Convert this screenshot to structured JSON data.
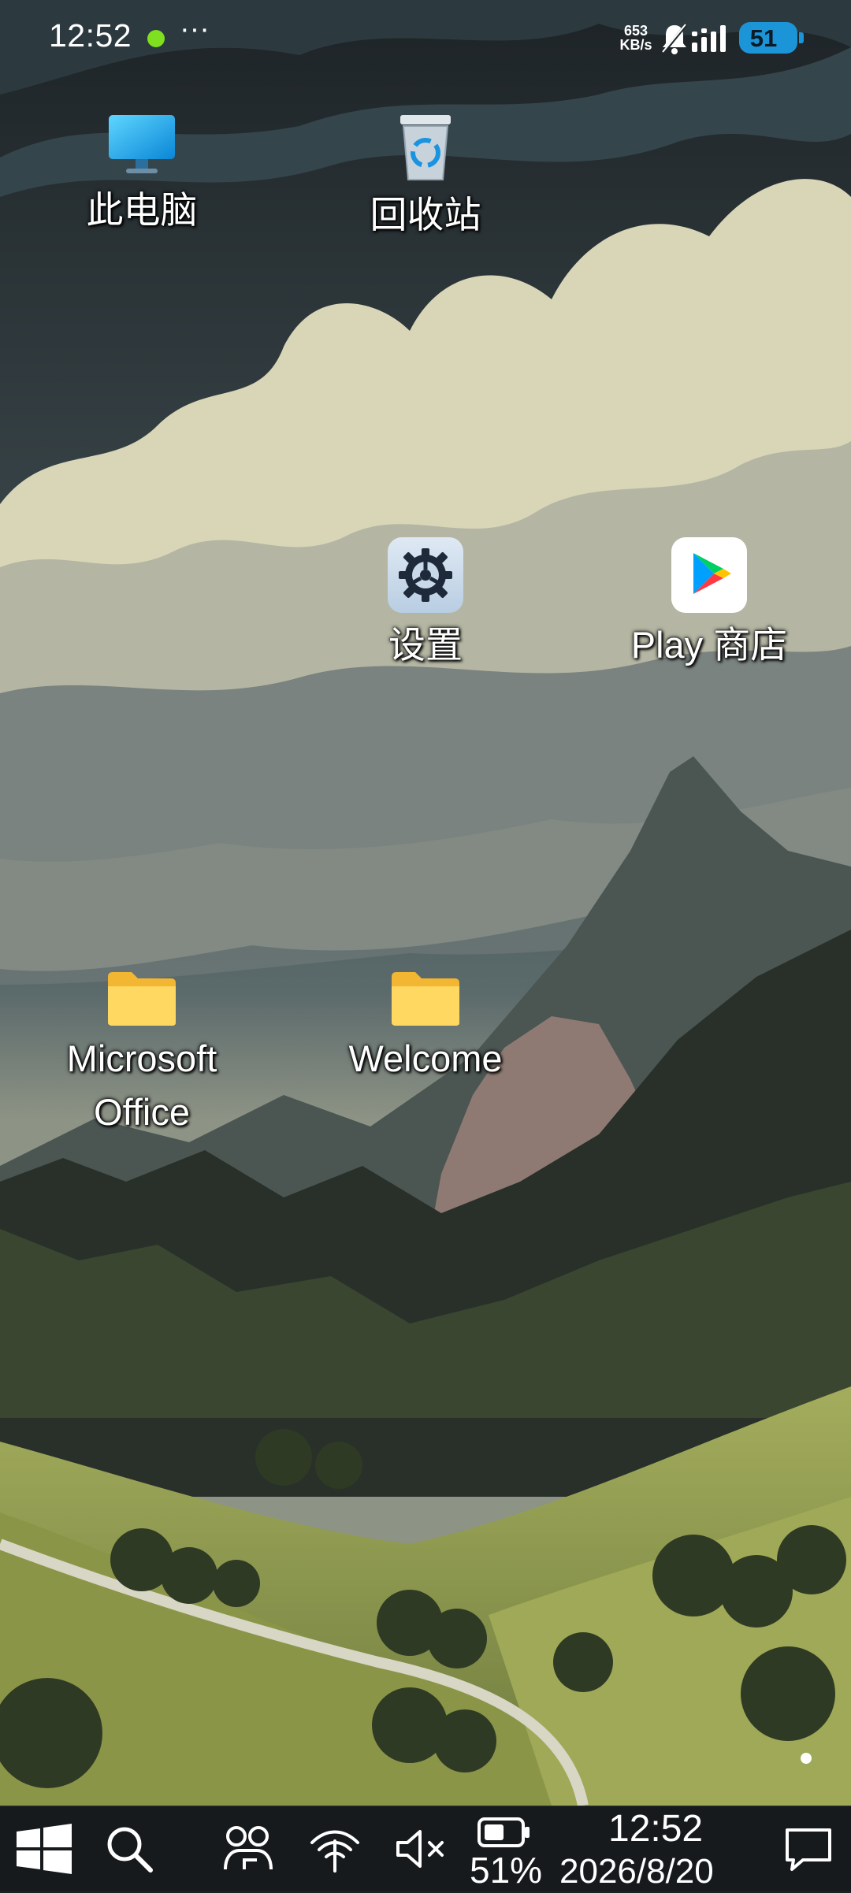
{
  "status_bar": {
    "time": "12:52",
    "net_speed_value": "653",
    "net_speed_unit": "KB/s",
    "battery_level": "51",
    "icons": [
      "online-dot-icon",
      "more-dots-icon",
      "bell-muted-icon",
      "signal-icon",
      "battery-icon"
    ],
    "colors": {
      "online_dot": "#7ee01e",
      "battery": "#1c95d8"
    }
  },
  "desktop": {
    "icons": [
      {
        "label": "此电脑",
        "icon": "monitor-icon"
      },
      {
        "label": "回收站",
        "icon": "recycle-bin-icon"
      },
      {
        "label": "设置",
        "icon": "gear-icon"
      },
      {
        "label": "Play 商店",
        "icon": "play-store-icon"
      },
      {
        "label_line1": "Microsoft",
        "label_line2": "Office",
        "icon": "folder-icon"
      },
      {
        "label": "Welcome",
        "icon": "folder-icon"
      }
    ]
  },
  "taskbar": {
    "items": [
      "windows-start-icon",
      "search-icon",
      "widgets-icon",
      "wifi-icon",
      "volume-muted-icon",
      "battery-icon",
      "notification-icon"
    ],
    "battery_percent": "51%",
    "clock_time": "12:52",
    "clock_date": "2026/8/20",
    "colors": {
      "background": "#161a1d"
    }
  }
}
